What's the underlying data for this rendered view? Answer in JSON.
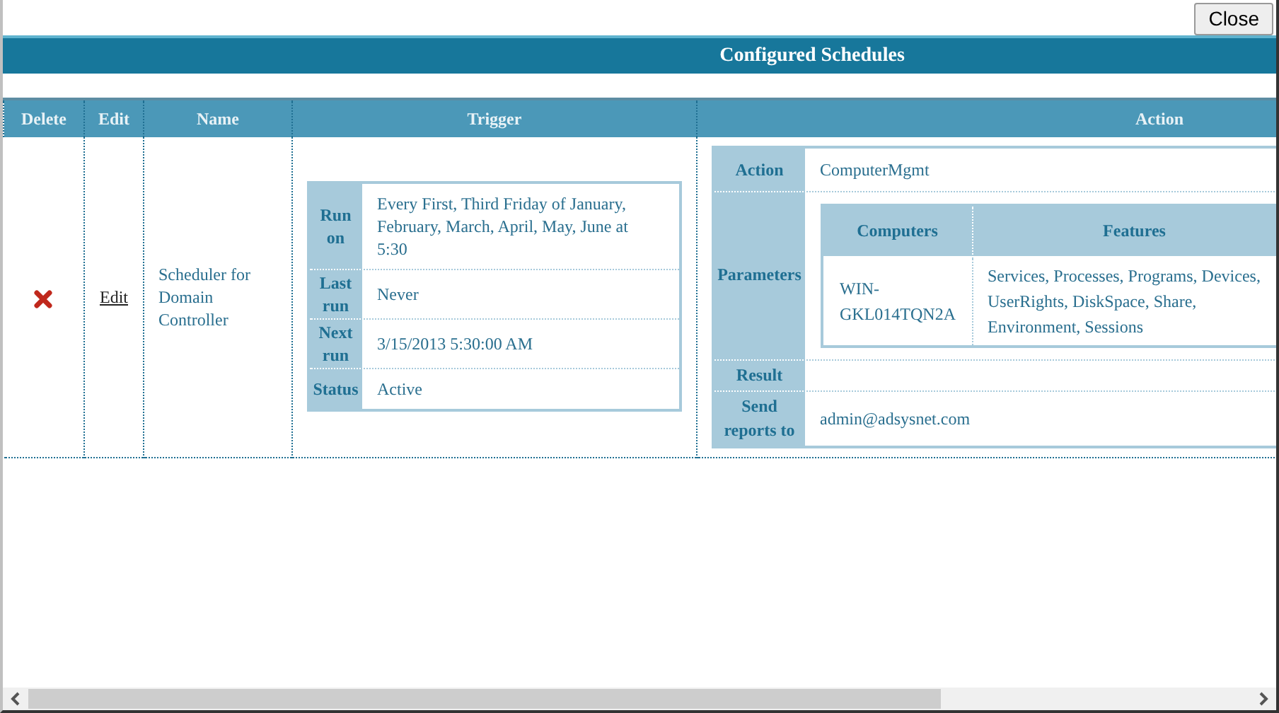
{
  "close_button": "Close",
  "title": "Configured Schedules",
  "table": {
    "columns": [
      "Delete",
      "Edit",
      "Name",
      "Trigger",
      "Action"
    ],
    "rows": [
      {
        "edit_link": "Edit",
        "name": "Scheduler for Domain Controller",
        "trigger": [
          {
            "label": "Run on",
            "value": "Every First, Third Friday of January, February, March, April, May, June at 5:30"
          },
          {
            "label": "Last run",
            "value": "Never"
          },
          {
            "label": "Next run",
            "value": "3/15/2013 5:30:00 AM"
          },
          {
            "label": "Status",
            "value": "Active"
          }
        ],
        "action": [
          {
            "kind": "text",
            "label": "Action",
            "value": "ComputerMgmt"
          },
          {
            "kind": "table",
            "label": "Parameters",
            "columns": [
              "Computers",
              "Features"
            ],
            "rows": [
              [
                "WIN-GKL014TQN2A",
                "Services, Processes, Programs, Devices, UserRights, DiskSpace, Share, Environment, Sessions"
              ]
            ]
          },
          {
            "kind": "empty",
            "label": "Result"
          },
          {
            "kind": "text",
            "label": "Send reports to",
            "value": "admin@adsysnet.com"
          }
        ]
      }
    ]
  }
}
